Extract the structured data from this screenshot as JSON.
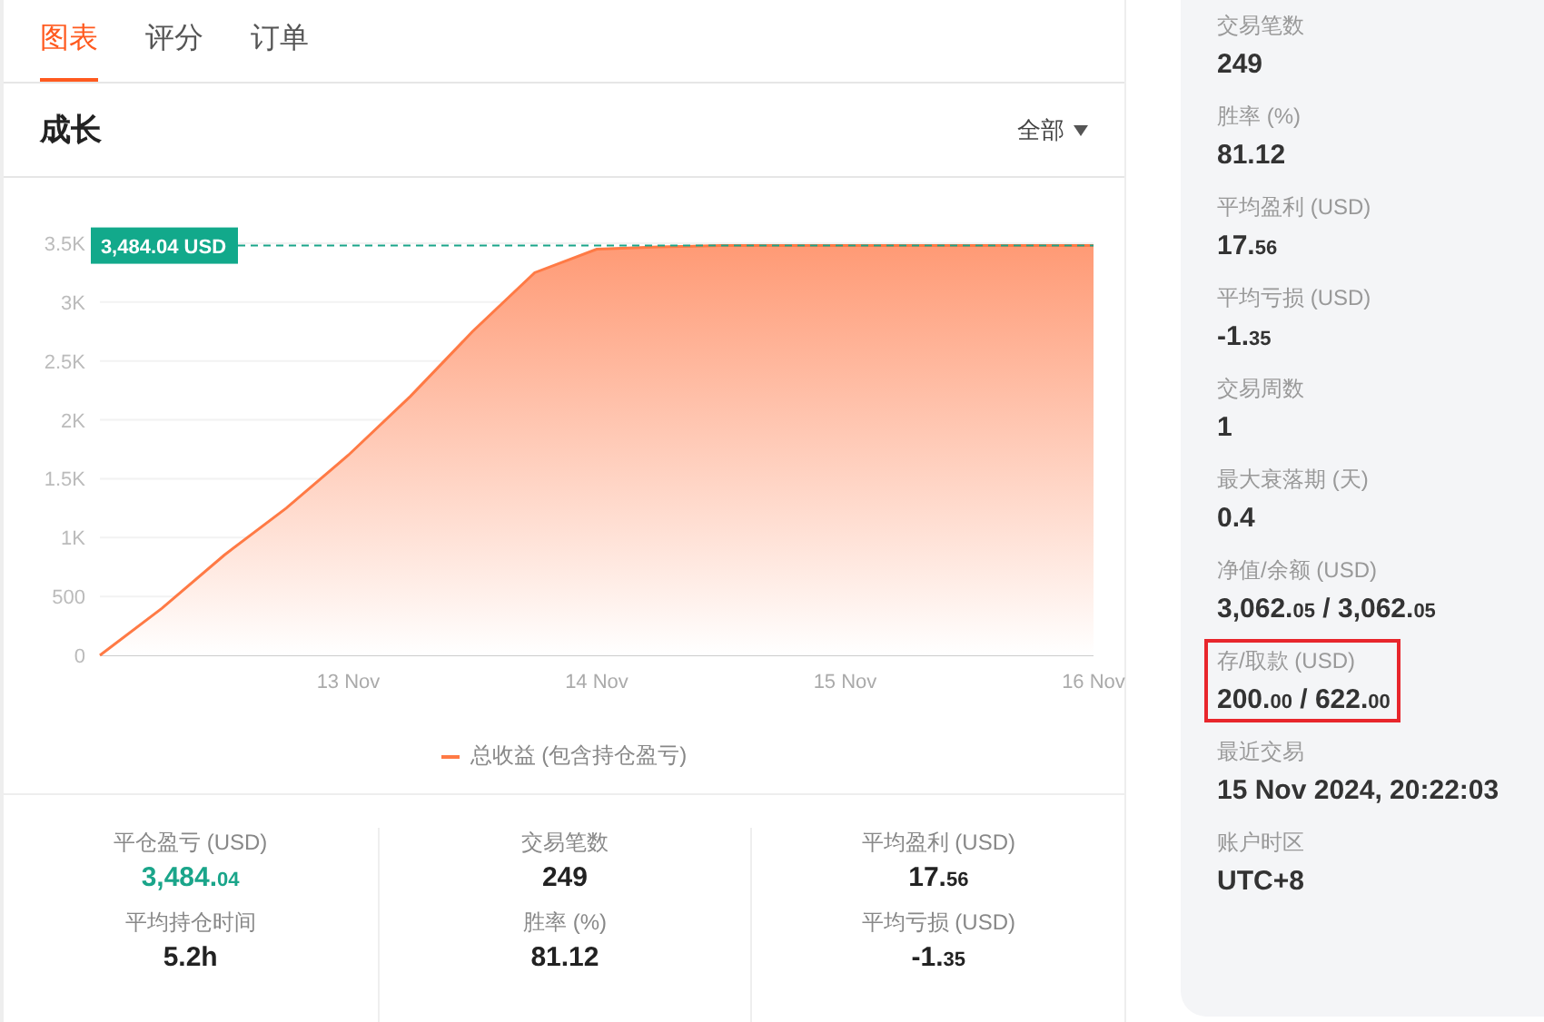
{
  "tabs": [
    {
      "label": "图表",
      "selected": true
    },
    {
      "label": "评分",
      "selected": false
    },
    {
      "label": "订单",
      "selected": false
    }
  ],
  "section": {
    "title": "成长",
    "filter": "全部"
  },
  "chart_data": {
    "type": "area",
    "categories": [
      null,
      null,
      null,
      null,
      "13 Nov",
      null,
      null,
      null,
      "14 Nov",
      null,
      null,
      null,
      "15 Nov",
      null,
      null,
      null,
      "16 Nov"
    ],
    "series": [
      {
        "name": "总收益 (包含持仓盈亏)",
        "color": "#ff7a45",
        "values": [
          0,
          400,
          850,
          1250,
          1700,
          2200,
          2750,
          3250,
          3450,
          3470,
          3480,
          3480,
          3480,
          3480,
          3480,
          3480,
          3480
        ]
      }
    ],
    "ylim": [
      0,
      3500
    ],
    "grid": true,
    "yticks": [
      {
        "value": 0,
        "label": "0"
      },
      {
        "value": 500,
        "label": "500"
      },
      {
        "value": 1000,
        "label": "1K"
      },
      {
        "value": 1500,
        "label": "1.5K"
      },
      {
        "value": 2000,
        "label": "2K"
      },
      {
        "value": 2500,
        "label": "2.5K"
      },
      {
        "value": 3000,
        "label": "3K"
      },
      {
        "value": 3500,
        "label": "3.5K"
      }
    ],
    "annotations": [
      "3,484.04 USD"
    ]
  },
  "stats": [
    {
      "label": "平仓盈亏 (USD)",
      "color": "#1aa58a",
      "parts": [
        {
          "text": "3,484.",
          "small": false
        },
        {
          "text": "04",
          "small": true
        }
      ]
    },
    {
      "label": "交易笔数",
      "color": "#222222",
      "parts": [
        {
          "text": "249",
          "small": false
        }
      ]
    },
    {
      "label": "平均盈利 (USD)",
      "color": "#222222",
      "parts": [
        {
          "text": "17.",
          "small": false
        },
        {
          "text": "56",
          "small": true
        }
      ]
    },
    {
      "label": "平均持仓时间",
      "color": "#222222",
      "parts": [
        {
          "text": "5.2h",
          "small": false
        }
      ]
    },
    {
      "label": "胜率 (%)",
      "color": "#222222",
      "parts": [
        {
          "text": "81.12",
          "small": false
        }
      ]
    },
    {
      "label": "平均亏损 (USD)",
      "color": "#222222",
      "parts": [
        {
          "text": "-1.",
          "small": false
        },
        {
          "text": "35",
          "small": true
        }
      ]
    }
  ],
  "sidebar": [
    {
      "label": "交易笔数",
      "highlighted": false,
      "parts": [
        {
          "text": "249",
          "small": false
        }
      ]
    },
    {
      "label": "胜率 (%)",
      "highlighted": false,
      "parts": [
        {
          "text": "81.12",
          "small": false
        }
      ]
    },
    {
      "label": "平均盈利 (USD)",
      "highlighted": false,
      "parts": [
        {
          "text": "17.",
          "small": false
        },
        {
          "text": "56",
          "small": true
        }
      ]
    },
    {
      "label": "平均亏损 (USD)",
      "highlighted": false,
      "parts": [
        {
          "text": "-1.",
          "small": false
        },
        {
          "text": "35",
          "small": true
        }
      ]
    },
    {
      "label": "交易周数",
      "highlighted": false,
      "parts": [
        {
          "text": "1",
          "small": false
        }
      ]
    },
    {
      "label": "最大衰落期 (天)",
      "highlighted": false,
      "parts": [
        {
          "text": "0.4",
          "small": false
        }
      ]
    },
    {
      "label": "净值/余额 (USD)",
      "highlighted": false,
      "parts": [
        {
          "text": "3,062.",
          "small": false
        },
        {
          "text": "05",
          "small": true
        },
        {
          "text": " / 3,062.",
          "small": false
        },
        {
          "text": "05",
          "small": true
        }
      ]
    },
    {
      "label": "存/取款 (USD)",
      "highlighted": true,
      "parts": [
        {
          "text": "200.",
          "small": false
        },
        {
          "text": "00",
          "small": true
        },
        {
          "text": " / 622.",
          "small": false
        },
        {
          "text": "00",
          "small": true
        }
      ]
    },
    {
      "label": "最近交易",
      "highlighted": false,
      "parts": [
        {
          "text": "15 Nov 2024, 20:22:03",
          "small": false
        }
      ]
    },
    {
      "label": "账户时区",
      "highlighted": false,
      "parts": [
        {
          "text": "UTC+8",
          "small": false
        }
      ]
    }
  ]
}
